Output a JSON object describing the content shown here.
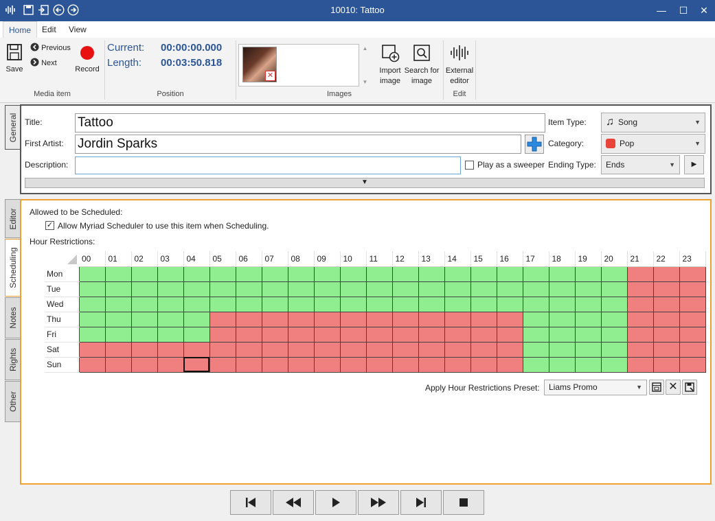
{
  "window": {
    "title": "10010: Tattoo"
  },
  "menu_tabs": [
    "Home",
    "Edit",
    "View"
  ],
  "ribbon": {
    "media_item": {
      "save": "Save",
      "previous": "Previous",
      "next": "Next",
      "record": "Record",
      "group": "Media item"
    },
    "position": {
      "current_label": "Current:",
      "current_value": "00:00:00.000",
      "length_label": "Length:",
      "length_value": "00:03:50.818",
      "group": "Position"
    },
    "images": {
      "group": "Images"
    },
    "import_image": [
      "Import",
      "image"
    ],
    "search_image": [
      "Search for",
      "image"
    ],
    "external_editor": [
      "External",
      "editor"
    ],
    "edit_group": "Edit"
  },
  "side_tabs": [
    "General",
    "Editor",
    "Scheduling",
    "Notes",
    "Rights",
    "Other"
  ],
  "general": {
    "title_label": "Title:",
    "title_value": "Tattoo",
    "artist_label": "First Artist:",
    "artist_value": "Jordin Sparks",
    "description_label": "Description:",
    "description_value": "",
    "sweeper_label": "Play as a sweeper",
    "item_type_label": "Item Type:",
    "item_type_value": "Song",
    "category_label": "Category:",
    "category_value": "Pop",
    "category_color": "#e8443a",
    "ending_type_label": "Ending Type:",
    "ending_type_value": "Ends"
  },
  "scheduling": {
    "allowed_label": "Allowed to be Scheduled:",
    "allow_checkbox_label": "Allow Myriad Scheduler to use this item when Scheduling.",
    "allow_checked": true,
    "hour_restrictions_label": "Hour Restrictions:",
    "hours": [
      "00",
      "01",
      "02",
      "03",
      "04",
      "05",
      "06",
      "07",
      "08",
      "09",
      "10",
      "11",
      "12",
      "13",
      "14",
      "15",
      "16",
      "17",
      "18",
      "19",
      "20",
      "21",
      "22",
      "23"
    ],
    "days": [
      {
        "name": "Mon",
        "cells": "gggggggggggggggggggggrrr"
      },
      {
        "name": "Tue",
        "cells": "gggggggggggggggggggggrrr"
      },
      {
        "name": "Wed",
        "cells": "gggggggggggggggggggggrrr"
      },
      {
        "name": "Thu",
        "cells": "gggggrrrrrrrrrrrrggggrrr"
      },
      {
        "name": "Fri",
        "cells": "gggggrrrrrrrrrrrrggggrrr"
      },
      {
        "name": "Sat",
        "cells": "rrrrrrrrrrrrrrrrrggggrrr"
      },
      {
        "name": "Sun",
        "cells": "rrrrrrrrrrrrrrrrrggggrrr"
      }
    ],
    "selected_cell": {
      "day": "Sun",
      "hour": "04"
    },
    "colors": {
      "allowed": "#90ee90",
      "blocked": "#f08080"
    },
    "preset_label": "Apply Hour Restrictions Preset:",
    "preset_value": "Liams Promo"
  },
  "transport": [
    "skip-to-start-icon",
    "rewind-icon",
    "play-icon",
    "fast-forward-icon",
    "skip-to-end-icon",
    "stop-icon"
  ]
}
